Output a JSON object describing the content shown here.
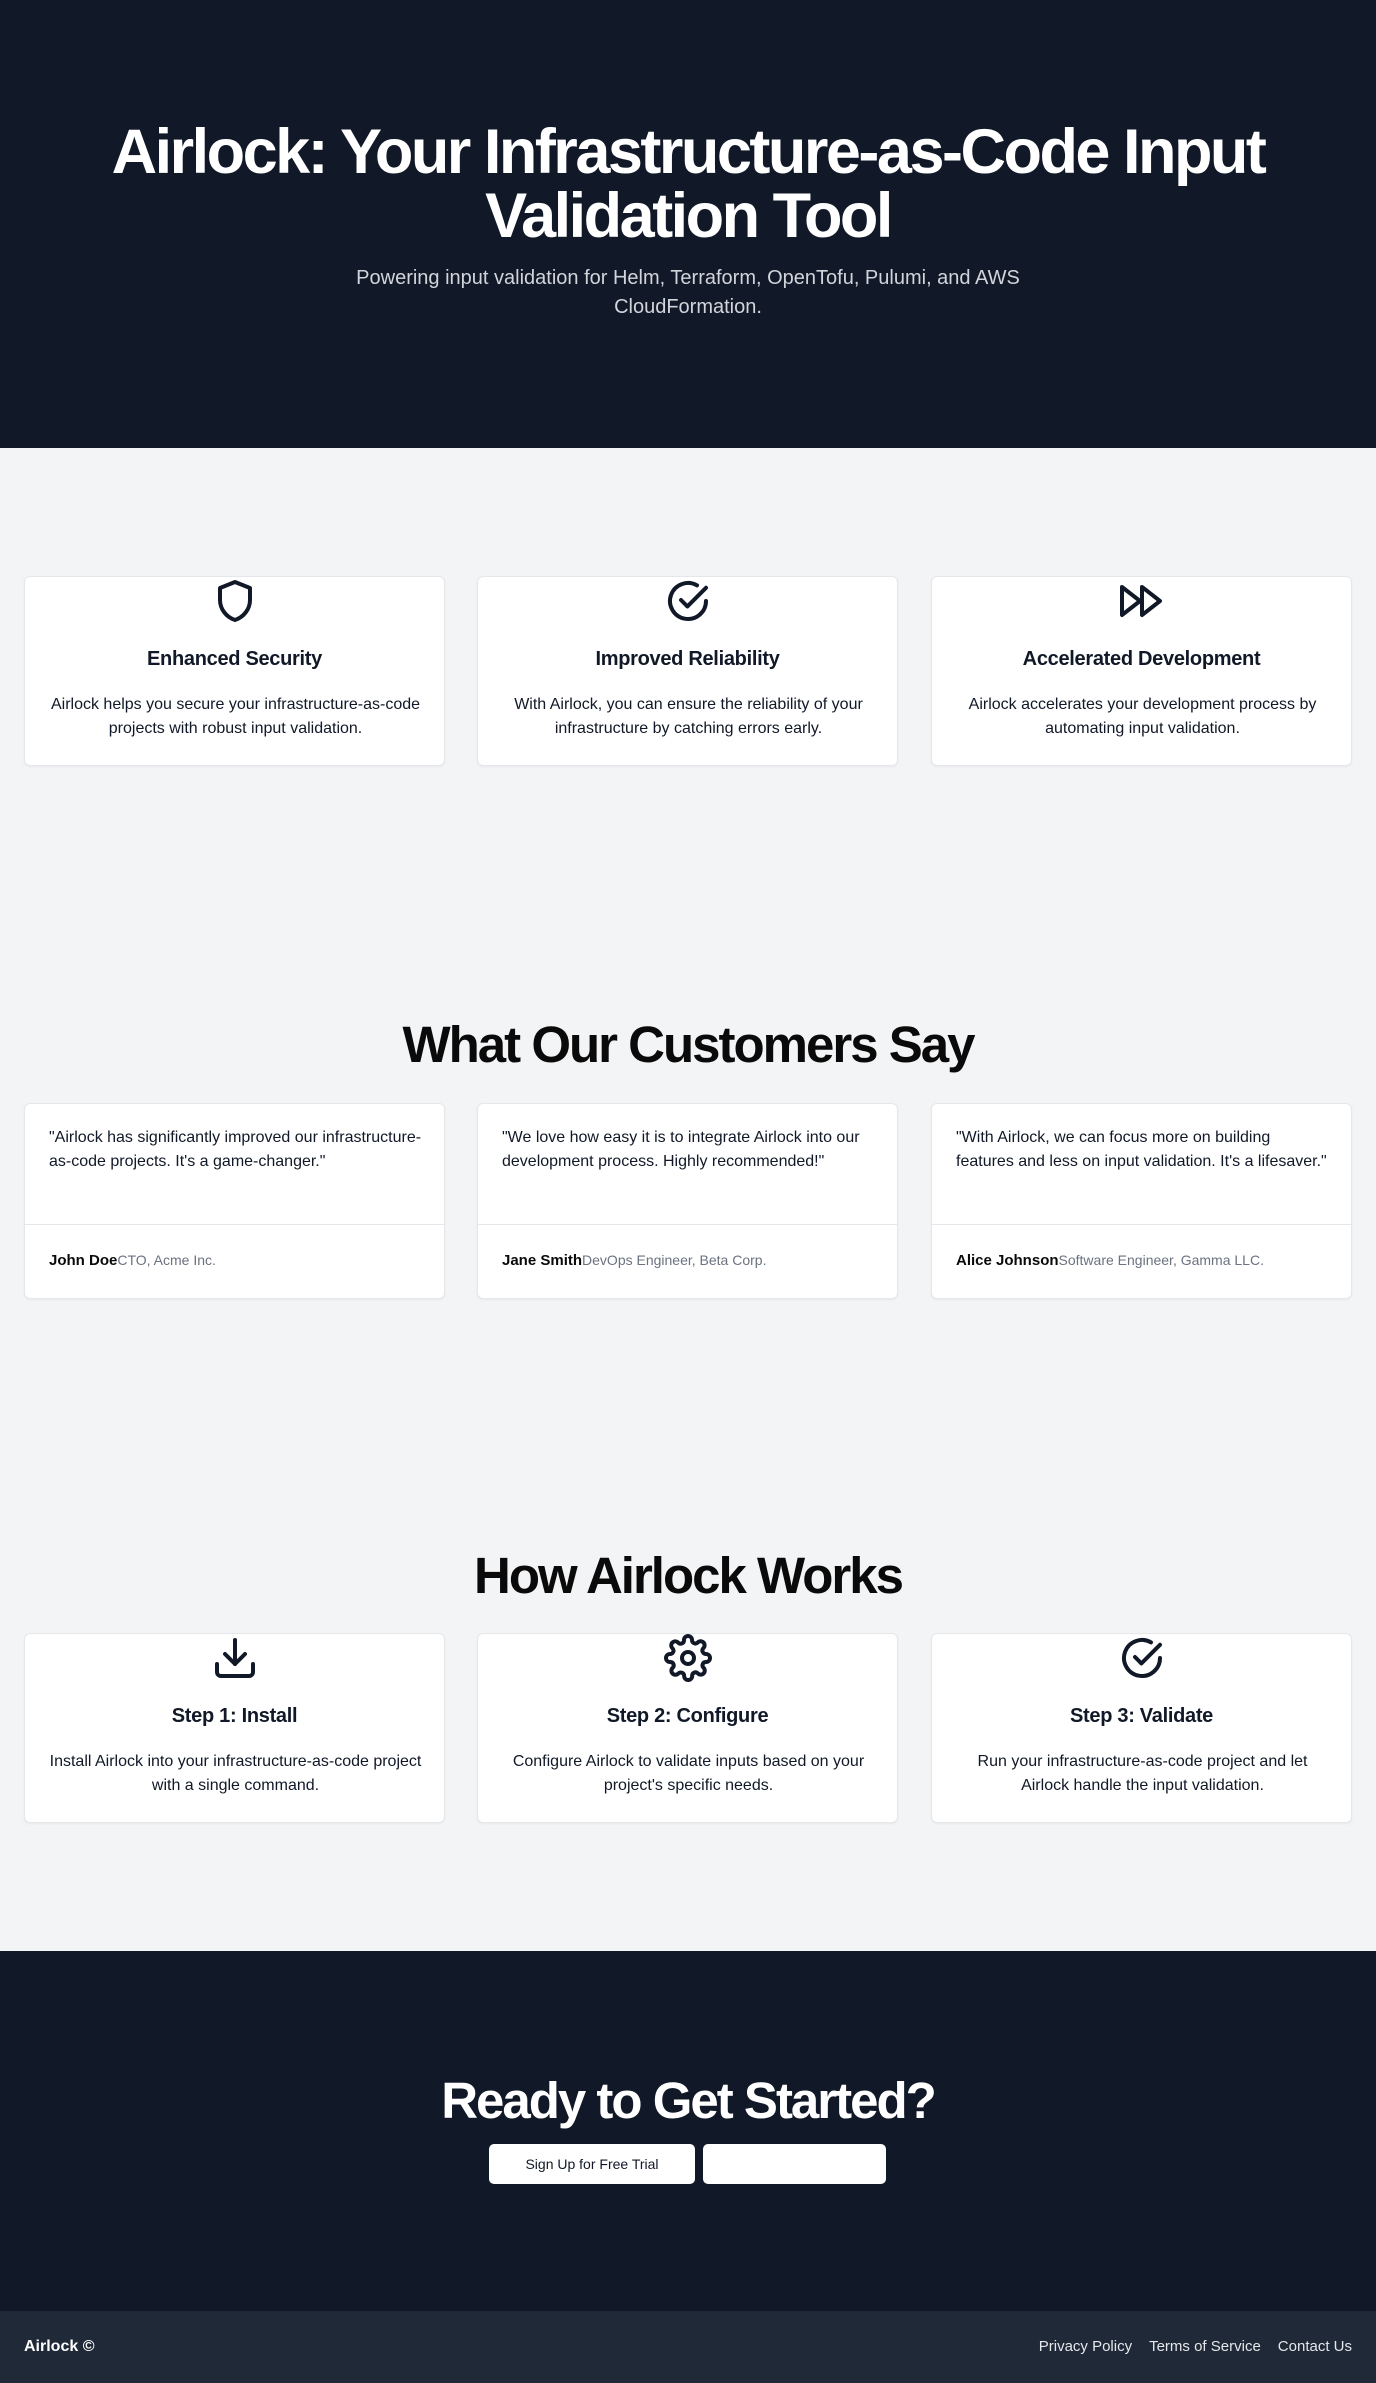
{
  "hero": {
    "title": "Airlock: Your Infrastructure-as-Code Input Validation Tool",
    "subtitle": "Powering input validation for Helm, Terraform, OpenTofu, Pulumi, and AWS CloudFormation."
  },
  "features": [
    {
      "icon": "shield-icon",
      "title": "Enhanced Security",
      "description": "Airlock helps you secure your infrastructure-as-code projects with robust input validation."
    },
    {
      "icon": "check-circle-icon",
      "title": "Improved Reliability",
      "description": "With Airlock, you can ensure the reliability of your infrastructure by catching errors early."
    },
    {
      "icon": "fast-forward-icon",
      "title": "Accelerated Development",
      "description": "Airlock accelerates your development process by automating input validation."
    }
  ],
  "testimonials": {
    "title": "What Our Customers Say",
    "items": [
      {
        "quote": "\"Airlock has significantly improved our infrastructure-as-code projects. It's a game-changer.\"",
        "name": "John Doe",
        "role": "CTO, Acme Inc."
      },
      {
        "quote": "\"We love how easy it is to integrate Airlock into our development process. Highly recommended!\"",
        "name": "Jane Smith",
        "role": "DevOps Engineer, Beta Corp."
      },
      {
        "quote": "\"With Airlock, we can focus more on building features and less on input validation. It's a lifesaver.\"",
        "name": "Alice Johnson",
        "role": "Software Engineer, Gamma LLC."
      }
    ]
  },
  "how": {
    "title": "How Airlock Works",
    "steps": [
      {
        "icon": "download-icon",
        "title": "Step 1: Install",
        "description": "Install Airlock into your infrastructure-as-code project with a single command."
      },
      {
        "icon": "gear-icon",
        "title": "Step 2: Configure",
        "description": "Configure Airlock to validate inputs based on your project's specific needs."
      },
      {
        "icon": "check-circle-icon",
        "title": "Step 3: Validate",
        "description": "Run your infrastructure-as-code project and let Airlock handle the input validation."
      }
    ]
  },
  "cta": {
    "title": "Ready to Get Started?",
    "primary_label": "Sign Up for Free Trial",
    "secondary_label": ""
  },
  "footer": {
    "brand": "Airlock ©",
    "links": [
      "Privacy Policy",
      "Terms of Service",
      "Contact Us"
    ]
  },
  "colors": {
    "dark": "#111827",
    "footer": "#1f2937",
    "page_bg": "#f3f4f6",
    "card_bg": "#ffffff",
    "muted": "#6b7280"
  }
}
